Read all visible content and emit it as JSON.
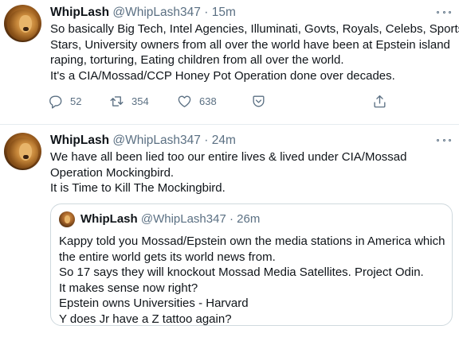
{
  "tweets": [
    {
      "name": "WhipLash",
      "handle": "@WhipLash347",
      "separator": "·",
      "time": "15m",
      "lines": [
        "So basically Big Tech, Intel Agencies, Illuminati, Govts, Royals, Celebs, Sports",
        "Stars, University owners from all over the world have been at Epstein island",
        "raping, torturing, Eating children from all over the world.",
        "It's a CIA/Mossad/CCP Honey Pot Operation done over decades."
      ],
      "actions": {
        "reply_count": "52",
        "retweet_count": "354",
        "like_count": "638"
      }
    },
    {
      "name": "WhipLash",
      "handle": "@WhipLash347",
      "separator": "·",
      "time": "24m",
      "lines": [
        "We have all been lied too our entire lives & lived under CIA/Mossad",
        "Operation Mockingbird.",
        "It is Time to Kill The Mockingbird."
      ],
      "quote": {
        "name": "WhipLash",
        "handle": "@WhipLash347",
        "separator": "·",
        "time": "26m",
        "lines": [
          "Kappy told you Mossad/Epstein own the media stations in America which",
          "the entire world gets its world news from.",
          "So 17 says they will knockout Mossad Media Satellites. Project Odin.",
          "It makes sense now right?",
          "Epstein owns Universities - Harvard",
          "Y does Jr have a Z tattoo again?"
        ]
      }
    }
  ],
  "icons": [
    "reply-icon",
    "retweet-icon",
    "like-icon",
    "bookmark-icon",
    "share-icon",
    "more-icon"
  ],
  "colors": {
    "text": "#0f1419",
    "muted": "#5b7083",
    "border": "#cfd9de",
    "divider": "#e6ecf0"
  }
}
